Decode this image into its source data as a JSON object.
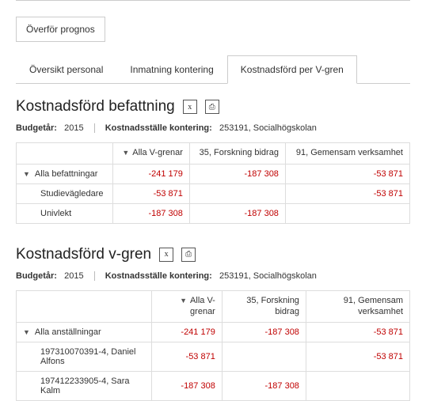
{
  "transfer_button": "Överför prognos",
  "tabs": [
    {
      "label": "Översikt personal",
      "active": false
    },
    {
      "label": "Inmatning kontering",
      "active": false
    },
    {
      "label": "Kostnadsförd per V-gren",
      "active": true
    }
  ],
  "section1": {
    "title": "Kostnadsförd befattning",
    "meta": {
      "budget_year_label": "Budgetår:",
      "budget_year": "2015",
      "cost_center_label": "Kostnadsställe kontering:",
      "cost_center": "253191, Socialhögskolan"
    },
    "columns": [
      "Alla V-grenar",
      "35, Forskning bidrag",
      "91, Gemensam verksamhet"
    ],
    "rows": [
      {
        "label": "Alla befattningar",
        "expandable": true,
        "indent": 0,
        "values": [
          "-241 179",
          "-187 308",
          "-53 871"
        ]
      },
      {
        "label": "Studievägledare",
        "expandable": false,
        "indent": 1,
        "values": [
          "-53 871",
          "",
          "-53 871"
        ]
      },
      {
        "label": "Univlekt",
        "expandable": false,
        "indent": 1,
        "values": [
          "-187 308",
          "-187 308",
          ""
        ]
      }
    ]
  },
  "section2": {
    "title": "Kostnadsförd v-gren",
    "meta": {
      "budget_year_label": "Budgetår:",
      "budget_year": "2015",
      "cost_center_label": "Kostnadsställe kontering:",
      "cost_center": "253191, Socialhögskolan"
    },
    "columns": [
      "Alla V-grenar",
      "35, Forskning bidrag",
      "91, Gemensam verksamhet"
    ],
    "rows": [
      {
        "label": "Alla anställningar",
        "expandable": true,
        "indent": 0,
        "values": [
          "-241 179",
          "-187 308",
          "-53 871"
        ]
      },
      {
        "label": "197310070391-4, Daniel Alfons",
        "expandable": false,
        "indent": 1,
        "values": [
          "-53 871",
          "",
          "-53 871"
        ]
      },
      {
        "label": "197412233905-4, Sara Kalm",
        "expandable": false,
        "indent": 1,
        "values": [
          "-187 308",
          "-187 308",
          ""
        ]
      }
    ]
  }
}
